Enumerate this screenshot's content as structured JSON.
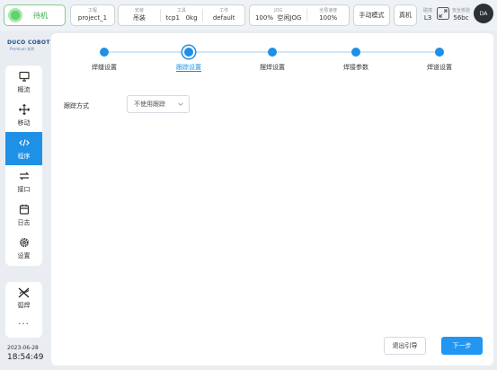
{
  "status": {
    "label": "待机",
    "color": "#3aa64a"
  },
  "project": {
    "label": "工程",
    "value": "project_1"
  },
  "install": {
    "label": "安装",
    "value": "吊装"
  },
  "tool": {
    "label": "工具",
    "value": "tcp1   0kg"
  },
  "workpiece": {
    "label": "工件",
    "value": "default"
  },
  "jog": {
    "label": "JOG",
    "value": "100%  空闲JOG"
  },
  "global_speed": {
    "label": "全局速度",
    "value": "100%"
  },
  "mode": {
    "label": "手动模式"
  },
  "real": {
    "label": "真机"
  },
  "collision": {
    "label": "碰撞",
    "value": "L3"
  },
  "safety": {
    "label": "安全校验",
    "value": "56bc"
  },
  "user": {
    "initials": "DA"
  },
  "logo": {
    "brand": "DUCO COBOT",
    "sub": "Premium 系列"
  },
  "sidebar": {
    "items": [
      {
        "label": "概流",
        "icon": "monitor-icon"
      },
      {
        "label": "移动",
        "icon": "move-arrows-icon"
      },
      {
        "label": "程序",
        "icon": "code-icon",
        "active": true
      },
      {
        "label": "接口",
        "icon": "swap-arrows-icon"
      },
      {
        "label": "日志",
        "icon": "calendar-icon"
      },
      {
        "label": "设置",
        "icon": "gear-icon"
      }
    ],
    "tool_arc": {
      "label": "弧焊",
      "icon": "welding-icon"
    },
    "more": "···"
  },
  "datetime": {
    "date": "2023-06-28",
    "time": "18:54:49"
  },
  "wizard": {
    "steps": [
      {
        "label": "焊缝设置"
      },
      {
        "label": "跟踪设置",
        "current": true
      },
      {
        "label": "摆焊设置"
      },
      {
        "label": "焊接参数"
      },
      {
        "label": "焊道设置"
      }
    ],
    "tracking_label": "跟踪方式",
    "tracking_value": "不使用跟踪",
    "exit_label": "退出引导",
    "next_label": "下一步"
  },
  "colors": {
    "accent": "#1e90e6",
    "success": "#3aa64a"
  }
}
